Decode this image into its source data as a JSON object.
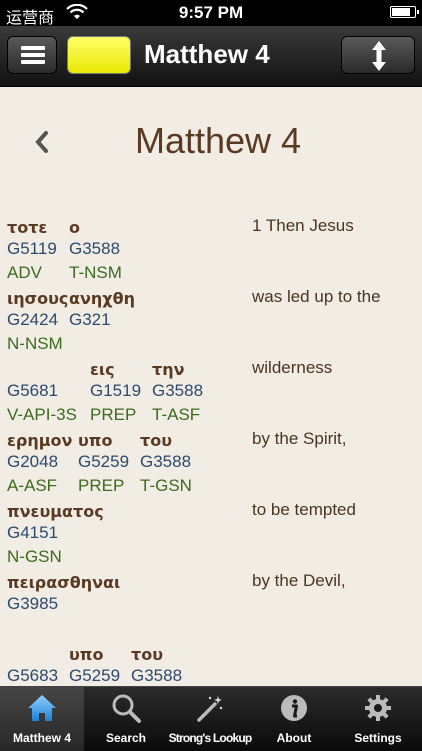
{
  "status_bar": {
    "carrier": "运营商",
    "time": "9:57 PM"
  },
  "nav": {
    "title": "Matthew 4"
  },
  "page": {
    "title": "Matthew 4"
  },
  "verses": [
    {
      "greek": [
        "τοτε",
        "ο"
      ],
      "strongs": [
        "G5119",
        "G3588"
      ],
      "morph": [
        "ADV",
        "T-NSM"
      ],
      "english": "1 Then Jesus"
    },
    {
      "greek": [
        "ιησους",
        "ανηχθη"
      ],
      "strongs": [
        "G2424",
        "G321"
      ],
      "morph": [
        "N-NSM"
      ],
      "english": "was led up to the"
    },
    {
      "greek": [
        "",
        "εις",
        "την"
      ],
      "strongs": [
        "G5681",
        "G1519",
        "G3588"
      ],
      "morph": [
        "V-API-3S",
        "PREP",
        "T-ASF"
      ],
      "english": "wilderness"
    },
    {
      "greek": [
        "ερημον",
        "υπο",
        "του"
      ],
      "strongs": [
        "G2048",
        "G5259",
        "G3588"
      ],
      "morph": [
        "A-ASF",
        "PREP",
        "T-GSN"
      ],
      "english": "by the Spirit,"
    },
    {
      "greek": [
        "πνευματος"
      ],
      "strongs": [
        "G4151"
      ],
      "morph": [
        "N-GSN"
      ],
      "english": "to be tempted"
    },
    {
      "greek": [
        "πειρασθηναι"
      ],
      "strongs": [
        "G3985"
      ],
      "morph": [],
      "english": "by the Devil,"
    },
    {
      "greek": [
        "",
        "υπο",
        "του"
      ],
      "strongs": [
        "G5683",
        "G5259",
        "G3588"
      ],
      "morph": [],
      "english": ""
    }
  ],
  "tabs": [
    {
      "label": "Matthew 4",
      "icon": "home-icon",
      "active": true
    },
    {
      "label": "Search",
      "icon": "search-icon",
      "active": false
    },
    {
      "label": "Strong's Lookup",
      "icon": "magic-wand-icon",
      "active": false
    },
    {
      "label": "About",
      "icon": "info-icon",
      "active": false
    },
    {
      "label": "Settings",
      "icon": "gear-icon",
      "active": false
    }
  ],
  "colors": {
    "background": "#f2ede4",
    "greek": "#5a3a22",
    "strongs": "#2b4a6e",
    "morph": "#3b6b1e",
    "highlight": "#ffff33"
  }
}
